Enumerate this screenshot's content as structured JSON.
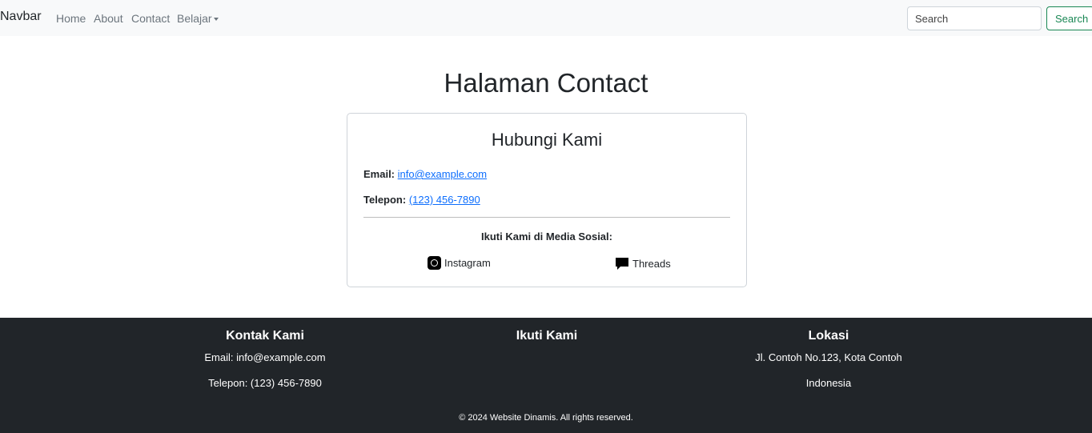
{
  "navbar": {
    "brand": "Navbar",
    "links": {
      "home": "Home",
      "about": "About",
      "contact": "Contact",
      "belajar": "Belajar"
    },
    "search_placeholder": "Search",
    "search_button": "Search"
  },
  "main": {
    "title": "Halaman Contact",
    "card": {
      "title": "Hubungi Kami",
      "email_label": "Email:",
      "email_value": "info@example.com",
      "phone_label": "Telepon:",
      "phone_value": "(123) 456-7890",
      "social_heading": "Ikuti Kami di Media Sosial:",
      "social": {
        "instagram": "Instagram",
        "threads": "Threads"
      },
      "icons": {
        "instagram": "instagram-icon",
        "threads": "speech-bubble-icon"
      }
    }
  },
  "footer": {
    "contact": {
      "heading": "Kontak Kami",
      "email": "Email: info@example.com",
      "phone": "Telepon: (123) 456-7890"
    },
    "follow": {
      "heading": "Ikuti Kami"
    },
    "location": {
      "heading": "Lokasi",
      "address": "Jl. Contoh No.123, Kota Contoh",
      "country": "Indonesia"
    },
    "copyright": "© 2024 Website Dinamis. All rights reserved."
  },
  "colors": {
    "navbar_bg": "#f8f9fa",
    "footer_bg": "#212529",
    "link": "#0d6efd",
    "search_button": "#198754"
  }
}
